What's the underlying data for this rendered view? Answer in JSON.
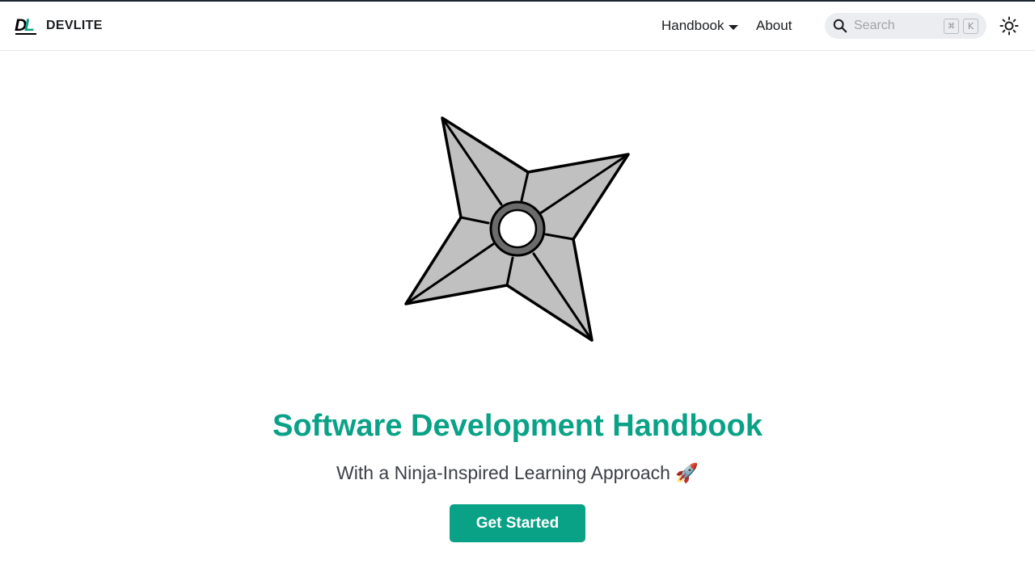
{
  "navbar": {
    "brand": {
      "name": "DEVLITE",
      "logo_letters": "DL"
    },
    "items": [
      {
        "label": "Handbook",
        "has_dropdown": true
      },
      {
        "label": "About"
      }
    ],
    "search": {
      "placeholder": "Search",
      "shortcut_keys": [
        "⌘",
        "K"
      ]
    },
    "theme_toggle_icon": "sun-icon"
  },
  "hero": {
    "image_icon": "shuriken-icon",
    "title": "Software Development Handbook",
    "subtitle": "With a Ninja-Inspired Learning Approach 🚀",
    "cta_label": "Get Started"
  },
  "colors": {
    "accent": "#0aa287",
    "text": "#1c1e21",
    "search_bg": "#ebedf0",
    "shuriken_fill": "#c0c0c0"
  }
}
